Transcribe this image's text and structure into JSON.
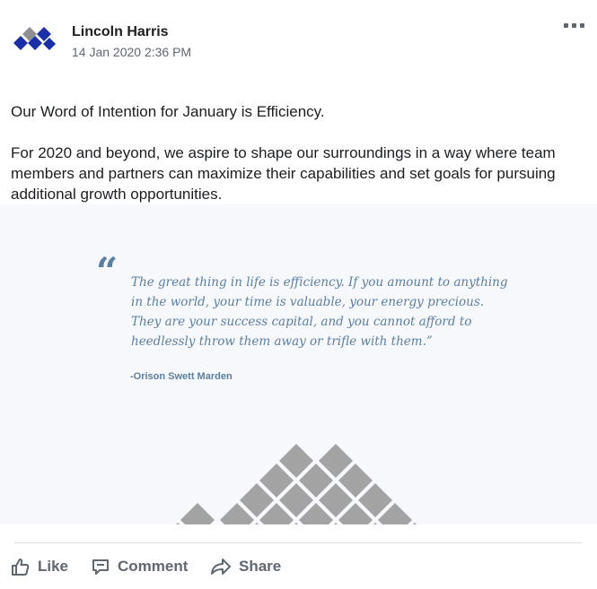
{
  "post": {
    "author": "Lincoln Harris",
    "timestamp": "14 Jan 2020 2:36 PM",
    "paragraphs": [
      "Our Word of Intention for January is Efficiency.",
      "For 2020 and beyond, we aspire to shape our surroundings in a way where team members and partners can maximize their capabilities and set goals for pursuing additional growth opportunities."
    ],
    "image": {
      "quote_mark": "“",
      "quote": "The great thing in life is efficiency. If you amount to anything in the world, your time is valuable, your energy precious. They are your success capital, and you cannot afford to heedlessly throw them away or trifle with them.”",
      "attribution": "-Orison Swett Marden"
    }
  },
  "actions": {
    "like_label": "Like",
    "comment_label": "Comment",
    "share_label": "Share"
  },
  "icons": {
    "avatar": "lincoln-harris-logo",
    "more": "more-options-icon",
    "like": "thumbs-up-icon",
    "comment": "comment-icon",
    "share": "share-arrow-icon"
  },
  "colors": {
    "logo_blue": "#1a2fa8",
    "logo_gray": "#8e9094",
    "quote_blue": "#5b7fa3",
    "pattern_gray": "#a3a3a3",
    "action_gray": "#606770"
  }
}
